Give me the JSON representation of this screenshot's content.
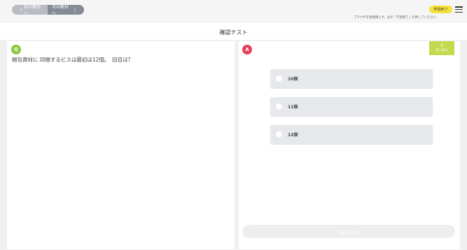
{
  "nav": {
    "prev_label": "前の教材へ",
    "next_label": "次の教材へ"
  },
  "header": {
    "finish_label": "学習終了",
    "notice": "ブラウザを直接閉じず、必ず「学習終了」を押してください"
  },
  "page": {
    "title": "確認テスト"
  },
  "question": {
    "badge": "Q",
    "text": "梱包資材に 同梱するビスは最初は12個。　回目は？"
  },
  "answer": {
    "badge": "A",
    "hint_mark": "?",
    "hint_label": "次へ戻る",
    "choices": [
      {
        "label": "10個"
      },
      {
        "label": "11個"
      },
      {
        "label": "12個"
      }
    ],
    "submit_label": "回答する"
  },
  "colors": {
    "q_badge": "#8cc63f",
    "a_badge": "#e8405a",
    "finish": "#f7e23a",
    "hint": "#c3d94e"
  }
}
